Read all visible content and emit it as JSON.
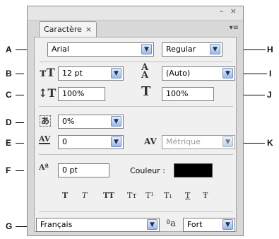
{
  "panel": {
    "tab_label": "Caractère",
    "tab_close": "×",
    "window_buttons": "– ×",
    "menu_icon": "▾≡"
  },
  "callouts": [
    "A",
    "B",
    "C",
    "D",
    "E",
    "F",
    "G",
    "H",
    "I",
    "J",
    "K"
  ],
  "font": {
    "family": "Arial",
    "style": "Regular"
  },
  "size": {
    "value": "12 pt"
  },
  "leading": {
    "value": "(Auto)"
  },
  "vertical_scale": {
    "value": "100%"
  },
  "horizontal_scale": {
    "value": "100%"
  },
  "tsume": {
    "value": "0%"
  },
  "tracking": {
    "value": "0"
  },
  "kerning": {
    "value": "Métrique"
  },
  "baseline_shift": {
    "value": "0 pt"
  },
  "color": {
    "label": "Couleur :",
    "swatch": "#000000"
  },
  "style_buttons": [
    "T",
    "T",
    "TT",
    "Tт",
    "T¹",
    "T₁",
    "T",
    "Ŧ"
  ],
  "language": {
    "value": "Français"
  },
  "antialias": {
    "icon": "ªa",
    "value": "Fort"
  }
}
